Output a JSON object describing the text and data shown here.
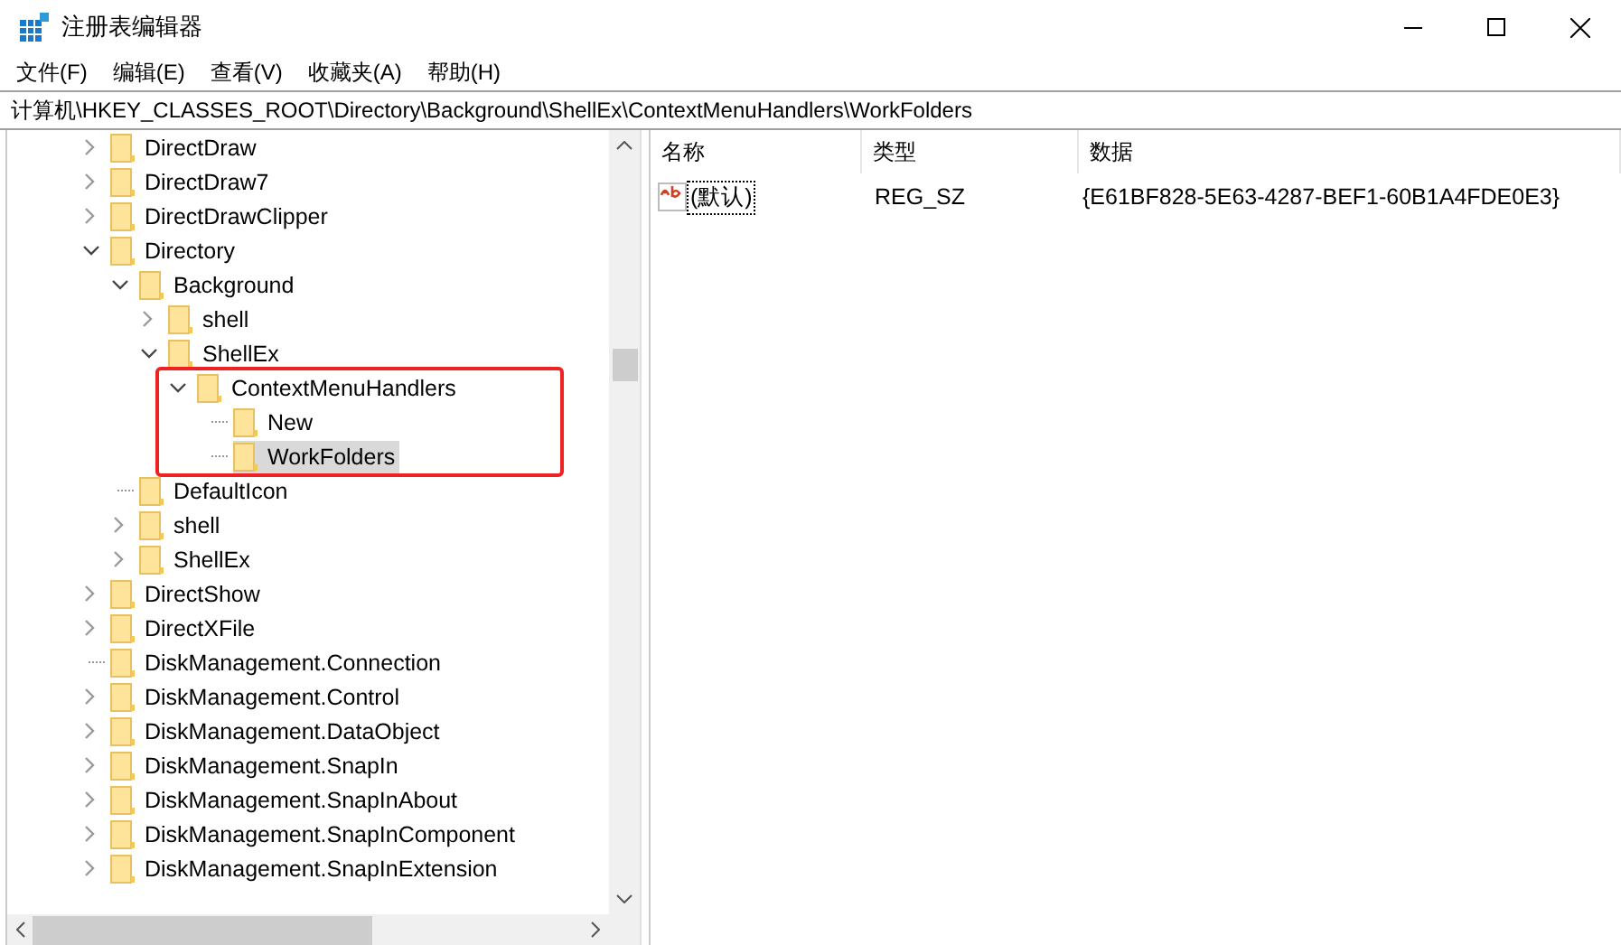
{
  "window": {
    "title": "注册表编辑器"
  },
  "menu": [
    "文件(F)",
    "编辑(E)",
    "查看(V)",
    "收藏夹(A)",
    "帮助(H)"
  ],
  "address": "计算机\\HKEY_CLASSES_ROOT\\Directory\\Background\\ShellEx\\ContextMenuHandlers\\WorkFolders",
  "tree": [
    {
      "label": "DirectDraw",
      "expandable": true,
      "expanded": false,
      "selected": false
    },
    {
      "label": "DirectDraw7",
      "expandable": true,
      "expanded": false,
      "selected": false
    },
    {
      "label": "DirectDrawClipper",
      "expandable": true,
      "expanded": false,
      "selected": false
    },
    {
      "label": "Directory",
      "expandable": true,
      "expanded": true,
      "selected": false,
      "children": [
        {
          "label": "Background",
          "expandable": true,
          "expanded": true,
          "selected": false,
          "children": [
            {
              "label": "shell",
              "expandable": true,
              "expanded": false,
              "selected": false
            },
            {
              "label": "ShellEx",
              "expandable": true,
              "expanded": true,
              "selected": false,
              "children": [
                {
                  "label": "ContextMenuHandlers",
                  "expandable": true,
                  "expanded": true,
                  "selected": false,
                  "highlighted": true,
                  "children": [
                    {
                      "label": "New",
                      "expandable": false,
                      "selected": false
                    },
                    {
                      "label": "WorkFolders",
                      "expandable": false,
                      "selected": true
                    }
                  ]
                }
              ]
            }
          ]
        },
        {
          "label": "DefaultIcon",
          "expandable": false,
          "selected": false
        },
        {
          "label": "shell",
          "expandable": true,
          "expanded": false,
          "selected": false
        },
        {
          "label": "ShellEx",
          "expandable": true,
          "expanded": false,
          "selected": false
        }
      ]
    },
    {
      "label": "DirectShow",
      "expandable": true,
      "expanded": false,
      "selected": false
    },
    {
      "label": "DirectXFile",
      "expandable": true,
      "expanded": false,
      "selected": false
    },
    {
      "label": "DiskManagement.Connection",
      "expandable": false,
      "selected": false
    },
    {
      "label": "DiskManagement.Control",
      "expandable": true,
      "expanded": false,
      "selected": false
    },
    {
      "label": "DiskManagement.DataObject",
      "expandable": true,
      "expanded": false,
      "selected": false
    },
    {
      "label": "DiskManagement.SnapIn",
      "expandable": true,
      "expanded": false,
      "selected": false
    },
    {
      "label": "DiskManagement.SnapInAbout",
      "expandable": true,
      "expanded": false,
      "selected": false
    },
    {
      "label": "DiskManagement.SnapInComponent",
      "expandable": true,
      "expanded": false,
      "selected": false
    },
    {
      "label": "DiskManagement.SnapInExtension",
      "expandable": true,
      "expanded": false,
      "selected": false
    }
  ],
  "values": {
    "columns": [
      "名称",
      "类型",
      "数据"
    ],
    "rows": [
      {
        "name": "(默认)",
        "type": "REG_SZ",
        "data": "{E61BF828-5E63-4287-BEF1-60B1A4FDE0E3}",
        "focused": true
      }
    ]
  }
}
